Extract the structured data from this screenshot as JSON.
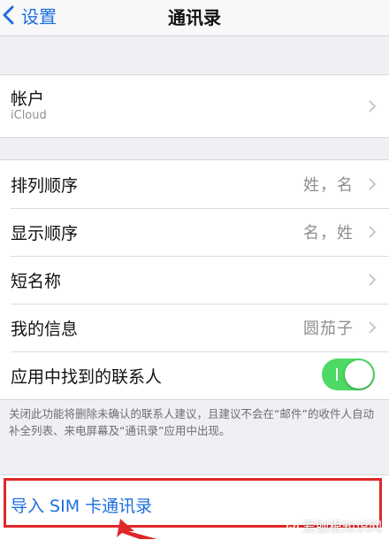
{
  "navbar": {
    "back_label": "设置",
    "title": "通讯录"
  },
  "account": {
    "label": "帐户",
    "sub": "iCloud"
  },
  "settings": [
    {
      "label": "排列顺序",
      "value": "姓，名"
    },
    {
      "label": "显示顺序",
      "value": "名，姓"
    },
    {
      "label": "短名称",
      "value": ""
    },
    {
      "label": "我的信息",
      "value": "圆茄子"
    }
  ],
  "contacts_found": {
    "label": "应用中找到的联系人",
    "enabled": true
  },
  "footnote": "关闭此功能将删除未确认的联系人建议，且建议不会在“邮件”的收件人自动补全列表、来电屏幕及“通讯录”应用中出现。",
  "import": {
    "label": "导入 SIM 卡通讯录"
  },
  "watermark": {
    "text": "爱刨根知识网"
  },
  "colors": {
    "accent": "#1d6fe0",
    "toggle_on": "#4cd964",
    "highlight": "#e02828"
  }
}
